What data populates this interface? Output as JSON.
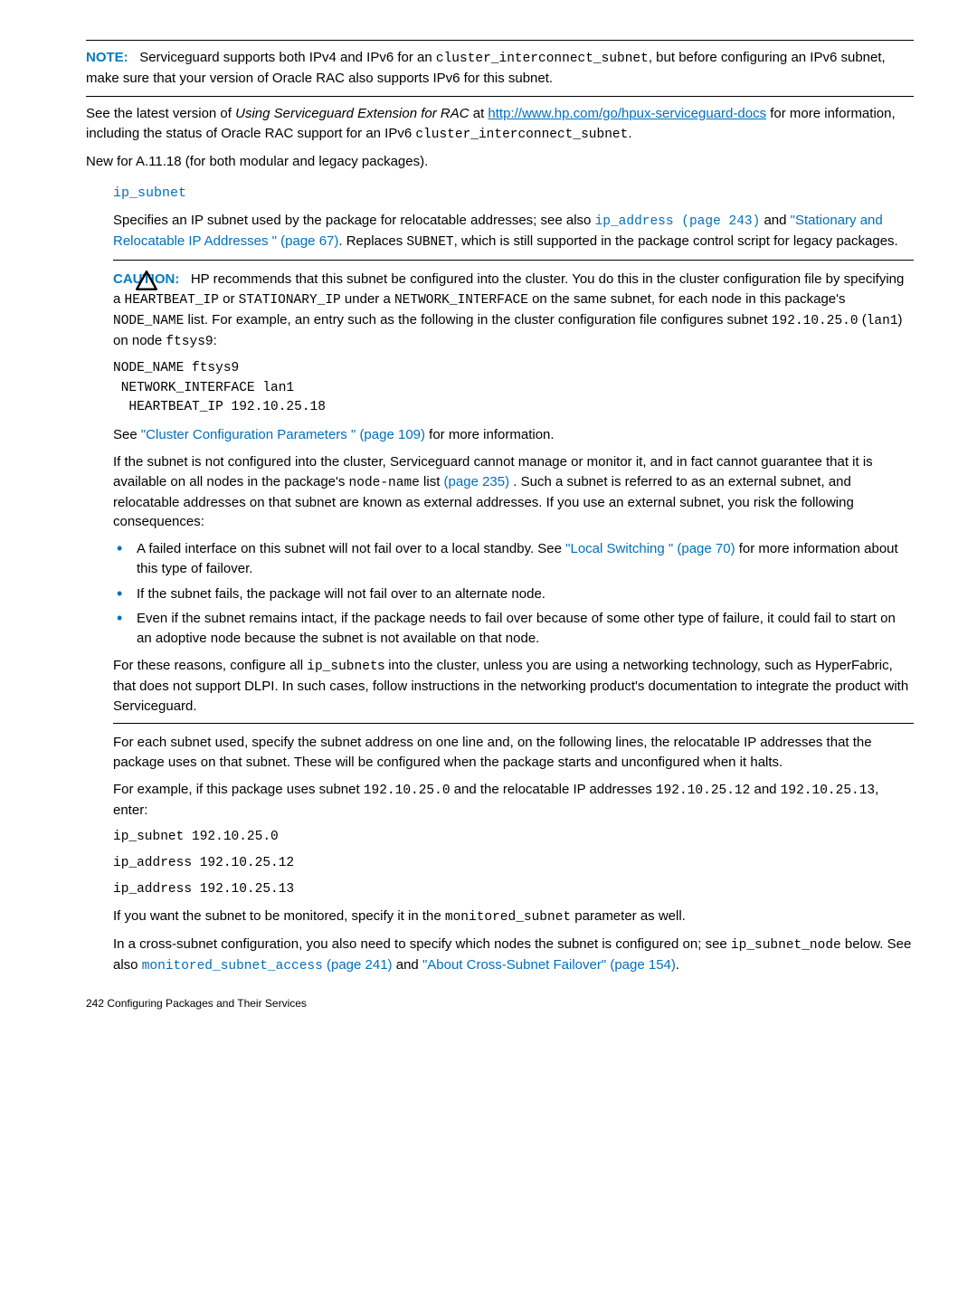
{
  "note": {
    "lead": "NOTE:",
    "body_pre": "Serviceguard supports both IPv4 and IPv6 for an ",
    "code1": "cluster_interconnect_subnet",
    "body_post": ", but before configuring an IPv6 subnet, make sure that your version of Oracle RAC also supports IPv6 for this subnet."
  },
  "para1": {
    "pre": "See the latest version of ",
    "italic": "Using Serviceguard Extension for RAC",
    "mid": " at ",
    "link": "http://www.hp.com/go/hpux-serviceguard-docs",
    "post": " for more information, including the status of Oracle RAC support for an IPv6 ",
    "code": "cluster_interconnect_subnet",
    "end": "."
  },
  "para2": "New for A.11.18 (for both modular and legacy packages).",
  "subhead": "ip_subnet",
  "para3": {
    "pre": "Specifies an IP subnet used by the package for relocatable addresses; see also ",
    "xref1": "ip_address (page 243)",
    "mid": " and ",
    "xref2": "\"Stationary and Relocatable IP Addresses \" (page 67)",
    "post": ". Replaces ",
    "code": "SUBNET",
    "end": ", which is still supported in the package control script for legacy packages."
  },
  "caution": {
    "lead": "CAUTION:",
    "l1_pre": "HP recommends that this subnet be configured into the cluster. You do this in the cluster configuration file by specifying a ",
    "c1": "HEARTBEAT_IP",
    "l1_mid1": " or ",
    "c2": "STATIONARY_IP",
    "l1_mid2": " under a ",
    "c3": "NETWORK_INTERFACE",
    "l1_mid3": " on the same subnet, for each node in this package's ",
    "c4": "NODE_NAME",
    "l1_post": " list. For example, an entry such as the following in the cluster configuration file configures subnet ",
    "c5": "192.10.25.0",
    "l1_mid4": " (",
    "c6": "lan1",
    "l1_mid5": ") on node ",
    "c7": "ftsys9",
    "l1_end": ":"
  },
  "codeblock": "NODE_NAME ftsys9\n NETWORK_INTERFACE lan1\n  HEARTBEAT_IP 192.10.25.18",
  "para4": {
    "pre": "See ",
    "xref": "\"Cluster Configuration Parameters \" (page 109)",
    "post": " for more information."
  },
  "para5": {
    "pre": "If the subnet is not configured into the cluster, Serviceguard cannot manage or monitor it, and in fact cannot guarantee that it is available on all nodes in the package's ",
    "code": "node-name",
    "mid": " list ",
    "xref": "(page 235)",
    "post": " . Such a subnet is referred to as an external subnet, and relocatable addresses on that subnet are known as external addresses. If you use an external subnet, you risk the following consequences:"
  },
  "bullets": [
    {
      "pre": "A failed interface on this subnet will not fail over to a local standby. See ",
      "xref": "\"Local Switching \" (page 70)",
      "post": " for more information about this type of failover."
    },
    {
      "plain": "If the subnet fails, the package will not fail over to an alternate node."
    },
    {
      "plain": "Even if the subnet remains intact, if the package needs to fail over because of some other type of failure, it could fail to start on an adoptive node because the subnet is not available on that node."
    }
  ],
  "para6": {
    "pre": "For these reasons, configure all ",
    "code": "ip_subnet",
    "post": "s into the cluster, unless you are using a networking technology, such as HyperFabric, that does not support DLPI. In such cases, follow instructions in the networking product's documentation to integrate the product with Serviceguard."
  },
  "para7": "For each subnet used, specify the subnet address on one line and, on the following lines, the relocatable IP addresses that the package uses on that subnet. These will be configured when the package starts and unconfigured when it halts.",
  "para8": {
    "pre": "For example, if this package uses subnet ",
    "c1": "192.10.25.0",
    "mid": " and the relocatable IP addresses ",
    "c2": "192.10.25.12",
    "mid2": " and ",
    "c3": "192.10.25.13",
    "post": ", enter:"
  },
  "cmds": [
    "ip_subnet 192.10.25.0",
    "ip_address 192.10.25.12",
    "ip_address 192.10.25.13"
  ],
  "para9": {
    "pre": "If you want the subnet to be monitored, specify it in the ",
    "code": "monitored_subnet",
    "post": " parameter as well."
  },
  "para10": {
    "pre": "In a cross-subnet configuration, you also need to specify which nodes the subnet is configured on; see ",
    "c1": "ip_subnet_node",
    "mid": " below. See also ",
    "x1a": "monitored_subnet_access",
    "x1b": " (page 241)",
    "mid2": " and ",
    "x2": "\"About Cross-Subnet Failover\" (page 154)",
    "post": "."
  },
  "footer": "242   Configuring Packages and Their Services"
}
